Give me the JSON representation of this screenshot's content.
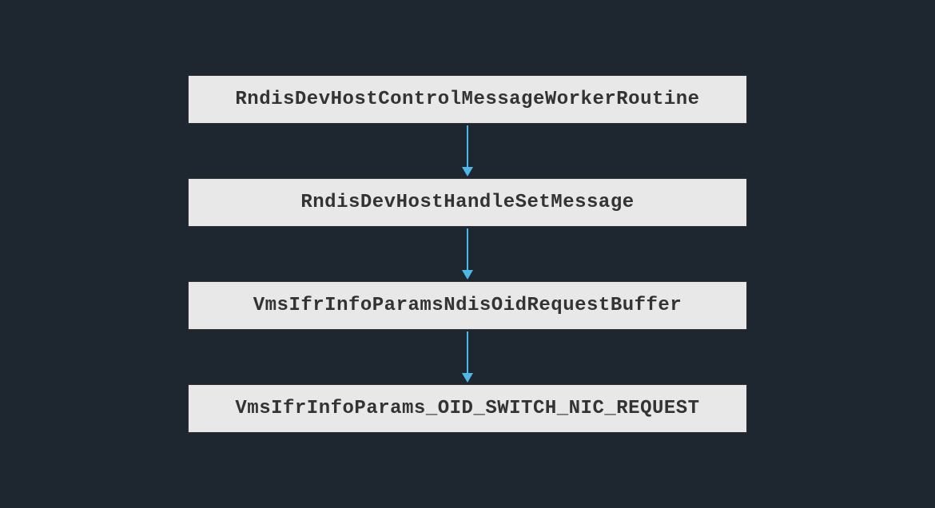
{
  "diagram": {
    "type": "flowchart",
    "direction": "vertical",
    "nodes": [
      {
        "label": "RndisDevHostControlMessageWorkerRoutine"
      },
      {
        "label": "RndisDevHostHandleSetMessage"
      },
      {
        "label": "VmsIfrInfoParamsNdisOidRequestBuffer"
      },
      {
        "label": "VmsIfrInfoParams_OID_SWITCH_NIC_REQUEST"
      }
    ],
    "colors": {
      "background": "#1e2730",
      "box_fill": "#e8e8e8",
      "box_border": "#333333",
      "text": "#333333",
      "arrow": "#4db8e8"
    }
  }
}
